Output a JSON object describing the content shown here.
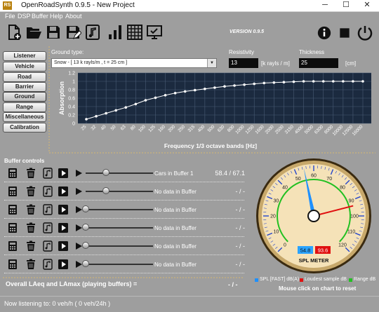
{
  "window": {
    "title": "OpenRoadSynth 0.9.5 - New Project",
    "app_icon_text": "RS",
    "minimize": "─",
    "maximize": "☐",
    "close": "✕"
  },
  "menu": [
    "File",
    "DSP",
    "Buffer",
    "Help",
    "About"
  ],
  "toolbar": {
    "icons": [
      "new-file-icon",
      "open-folder-icon",
      "save-icon",
      "save-as-icon",
      "music-note-icon",
      "bar-chart-icon",
      "grid-icon",
      "monitor-icon"
    ],
    "version": "VERSION 0.9.5",
    "right_icons": [
      "info-icon",
      "stop-icon",
      "power-icon"
    ]
  },
  "sidebar": {
    "items": [
      "Listener",
      "Vehicle",
      "Road",
      "Barrier",
      "Ground",
      "Range",
      "Miscellaneous",
      "Calibration"
    ],
    "active": "Ground"
  },
  "ground": {
    "type_label": "Ground type:",
    "type_value": "Snow - [ 13 k rayls/m , t = 25 cm ]",
    "resistivity_label": "Resistivity",
    "resistivity_value": "13",
    "resistivity_unit": "[k rayls / m]",
    "thickness_label": "Thickness",
    "thickness_value": "25",
    "thickness_unit": "[cm]"
  },
  "chart_data": {
    "type": "line",
    "title": "",
    "xlabel": "Frequency 1/3 octave bands [Hz]",
    "ylabel": "Absorption",
    "ylim": [
      0,
      1.2
    ],
    "yticks": [
      "0",
      "0.2",
      "0.4",
      "0.6",
      "0.8",
      "1",
      "1.2"
    ],
    "categories": [
      "25",
      "32",
      "40",
      "50",
      "63",
      "80",
      "100",
      "125",
      "160",
      "200",
      "250",
      "315",
      "400",
      "500",
      "630",
      "800",
      "1000",
      "1250",
      "1600",
      "2000",
      "2500",
      "3150",
      "4000",
      "5000",
      "6300",
      "8000",
      "10000",
      "12500",
      "16000"
    ],
    "values": [
      0.1,
      0.17,
      0.24,
      0.31,
      0.38,
      0.46,
      0.55,
      0.61,
      0.67,
      0.72,
      0.76,
      0.79,
      0.82,
      0.85,
      0.88,
      0.9,
      0.92,
      0.94,
      0.96,
      0.97,
      0.98,
      0.99,
      1.0,
      1.0,
      1.0,
      1.0,
      1.0,
      1.0,
      1.0
    ],
    "grid": true,
    "colors": {
      "background": "#1b2a3f",
      "line": "#ffffff",
      "grid": "#4a5c75"
    }
  },
  "buffers": {
    "title": "Buffer controls",
    "rows": [
      {
        "label": "Cars in Buffer 1",
        "value": "58.4 / 67.1",
        "slider": 0.3
      },
      {
        "label": "No data in Buffer",
        "value": "- / -",
        "slider": 0.3
      },
      {
        "label": "No data in Buffer",
        "value": "- / -",
        "slider": 0.0
      },
      {
        "label": "No data in Buffer",
        "value": "- / -",
        "slider": 0.0
      },
      {
        "label": "No data in Buffer",
        "value": "- / -",
        "slider": 0.0
      },
      {
        "label": "No data in Buffer",
        "value": "- / -",
        "slider": 0.0
      }
    ],
    "overall_label": "Overall LAeq and LAmax (playing buffers) =",
    "overall_value": "- / -"
  },
  "spl_meter": {
    "label": "SPL METER",
    "min": 0,
    "max": 120,
    "tick_labels": [
      "0",
      "10",
      "20",
      "30",
      "40",
      "50",
      "60",
      "70",
      "80",
      "90",
      "100",
      "110",
      "120"
    ],
    "fast_reading": 54.8,
    "loudest_reading": 93.6,
    "fast_display": "54.8",
    "loudest_display": "93.6",
    "legend": [
      "SPL [FAST] dB(A)",
      "Loudest sample dB",
      "Range dB"
    ],
    "colors": {
      "fast": "#1e90ff",
      "loudest": "#e01010",
      "range": "#22c022",
      "face": "#f5e2b8"
    },
    "hint": "Mouse click on chart to reset"
  },
  "status": "Now listening to: 0 veh/h ( 0 veh/24h )"
}
